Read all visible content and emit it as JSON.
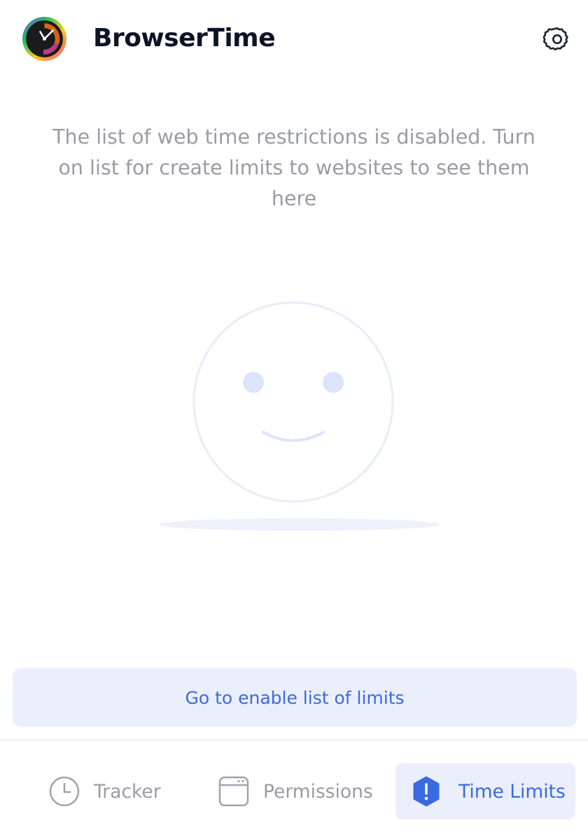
{
  "header": {
    "app_title": "BrowserTime",
    "logo_icon": "clock-logo-icon",
    "settings_icon": "gear-icon"
  },
  "empty_state": {
    "message": "The list of web time restrictions is disabled. Turn on list for create limits to websites to see them here",
    "illustration_icon": "smiley-face-icon"
  },
  "cta": {
    "label": "Go to enable list of limits"
  },
  "nav": {
    "items": [
      {
        "label": "Tracker",
        "icon": "clock-icon",
        "active": false
      },
      {
        "label": "Permissions",
        "icon": "browser-window-icon",
        "active": false
      },
      {
        "label": "Time Limits",
        "icon": "alert-hexagon-icon",
        "active": true
      }
    ]
  },
  "colors": {
    "accent": "#3b6ae0",
    "accent_bg": "#ebeffb",
    "muted_text": "#9a9ba6",
    "title_text": "#0c1426"
  }
}
